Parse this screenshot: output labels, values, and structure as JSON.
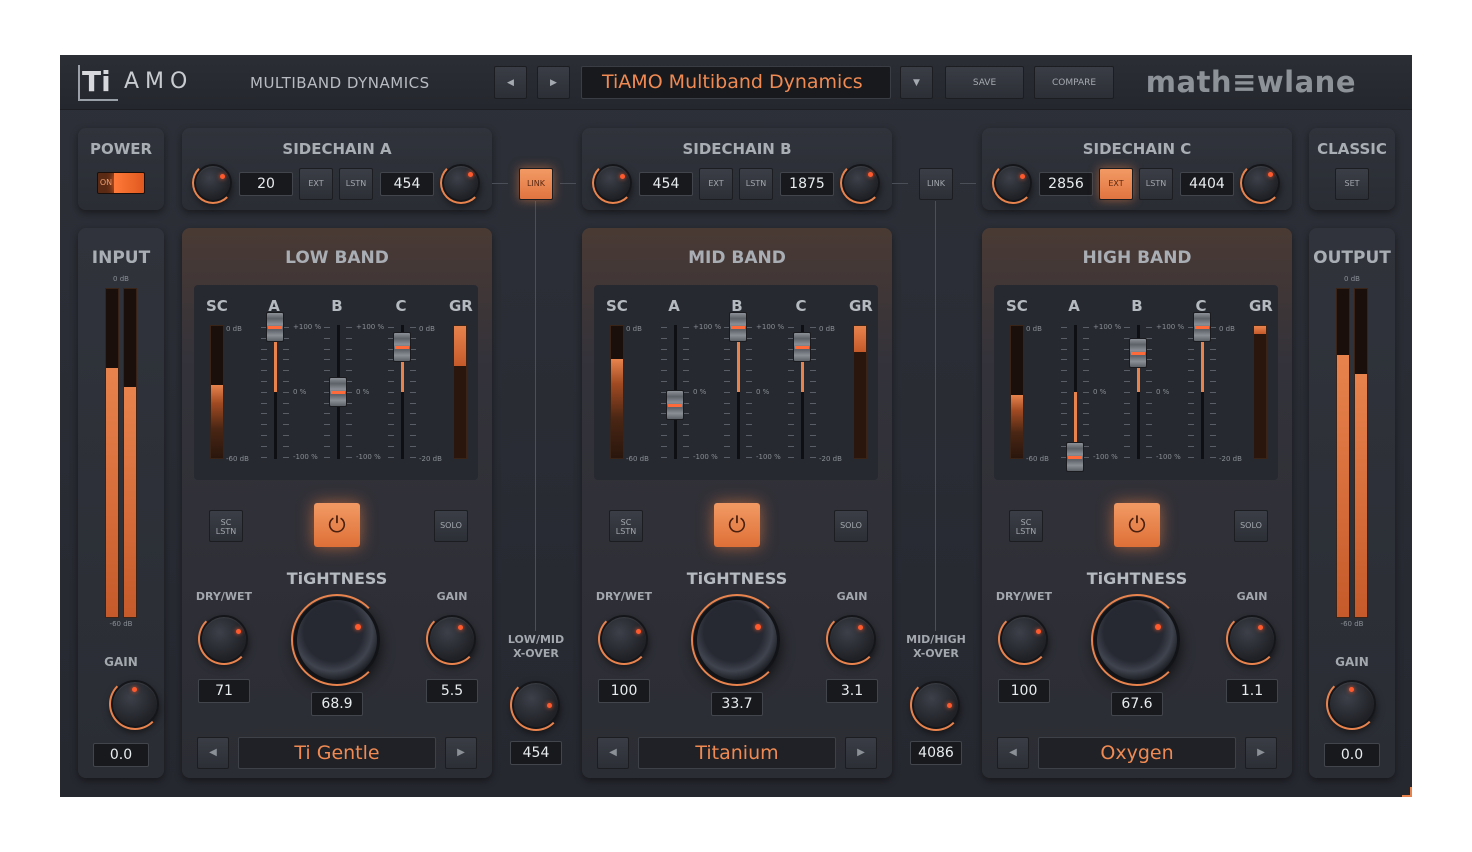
{
  "header": {
    "logo_ti": "Ti",
    "logo_rest": "AMO",
    "subtitle": "MULTIBAND DYNAMICS",
    "prev_label": "◀",
    "next_label": "▶",
    "preset_name": "TiAMO Multiband Dynamics",
    "preset_dropdown": "▼",
    "save_label": "SAVE",
    "compare_label": "COMPARE",
    "brand": "math≡wlane"
  },
  "power": {
    "title": "POWER",
    "toggle_label": "ON"
  },
  "classic": {
    "title": "CLASSIC",
    "set_label": "SET"
  },
  "sidechains": [
    {
      "title": "SIDECHAIN A",
      "low": "20",
      "ext": "EXT",
      "lstn": "LSTN",
      "high": "454",
      "ext_on": false
    },
    {
      "title": "SIDECHAIN B",
      "low": "454",
      "ext": "EXT",
      "lstn": "LSTN",
      "high": "1875",
      "ext_on": false
    },
    {
      "title": "SIDECHAIN C",
      "low": "2856",
      "ext": "EXT",
      "lstn": "LSTN",
      "high": "4404",
      "ext_on": true
    }
  ],
  "links": [
    {
      "label": "LINK",
      "active": true
    },
    {
      "label": "LINK",
      "active": false
    }
  ],
  "input": {
    "title": "INPUT",
    "top": "0 dB",
    "bottom": "-60 dB",
    "gain_label": "GAIN",
    "gain_value": "0.0",
    "levels": [
      0.76,
      0.7
    ]
  },
  "output": {
    "title": "OUTPUT",
    "top": "0 dB",
    "bottom": "-60 dB",
    "gain_label": "GAIN",
    "gain_value": "0.0",
    "levels": [
      0.8,
      0.74
    ]
  },
  "mixer_labels": {
    "sc": "SC",
    "a": "A",
    "b": "B",
    "c": "C",
    "gr": "GR",
    "sc_top": "0 dB",
    "sc_bottom": "-60 dB",
    "gr_top": "0 dB",
    "gr_bottom": "-20 dB",
    "p100": "+100 %",
    "p0": "0 %",
    "m100": "-100 %"
  },
  "bands": [
    {
      "title": "LOW BAND",
      "sc_lstn": "SC LSTN",
      "solo": "SOLO",
      "tightness": "TiGHTNESS",
      "drywet_label": "DRY/WET",
      "drywet": "71",
      "tight_value": "68.9",
      "gain_label": "GAIN",
      "gain": "5.5",
      "preset": "Ti Gentle",
      "fader_a": 1.0,
      "fader_b": 0.0,
      "fader_c": 0.7,
      "sc_level": 0.55,
      "gr_level": 0.3
    },
    {
      "title": "MID BAND",
      "sc_lstn": "SC LSTN",
      "solo": "SOLO",
      "tightness": "TiGHTNESS",
      "drywet_label": "DRY/WET",
      "drywet": "100",
      "tight_value": "33.7",
      "gain_label": "GAIN",
      "gain": "3.1",
      "preset": "Titanium",
      "fader_a": -0.2,
      "fader_b": 1.0,
      "fader_c": 0.7,
      "sc_level": 0.75,
      "gr_level": 0.2
    },
    {
      "title": "HIGH BAND",
      "sc_lstn": "SC LSTN",
      "solo": "SOLO",
      "tightness": "TiGHTNESS",
      "drywet_label": "DRY/WET",
      "drywet": "100",
      "tight_value": "67.6",
      "gain_label": "GAIN",
      "gain": "1.1",
      "preset": "Oxygen",
      "fader_a": -1.0,
      "fader_b": 0.6,
      "fader_c": 1.0,
      "sc_level": 0.48,
      "gr_level": 0.05
    }
  ],
  "xovers": [
    {
      "label_1": "LOW/MID",
      "label_2": "X-OVER",
      "value": "454"
    },
    {
      "label_1": "MID/HIGH",
      "label_2": "X-OVER",
      "value": "4086"
    }
  ],
  "power_icon": "power-icon",
  "arrow_left": "◀",
  "arrow_right": "▶"
}
